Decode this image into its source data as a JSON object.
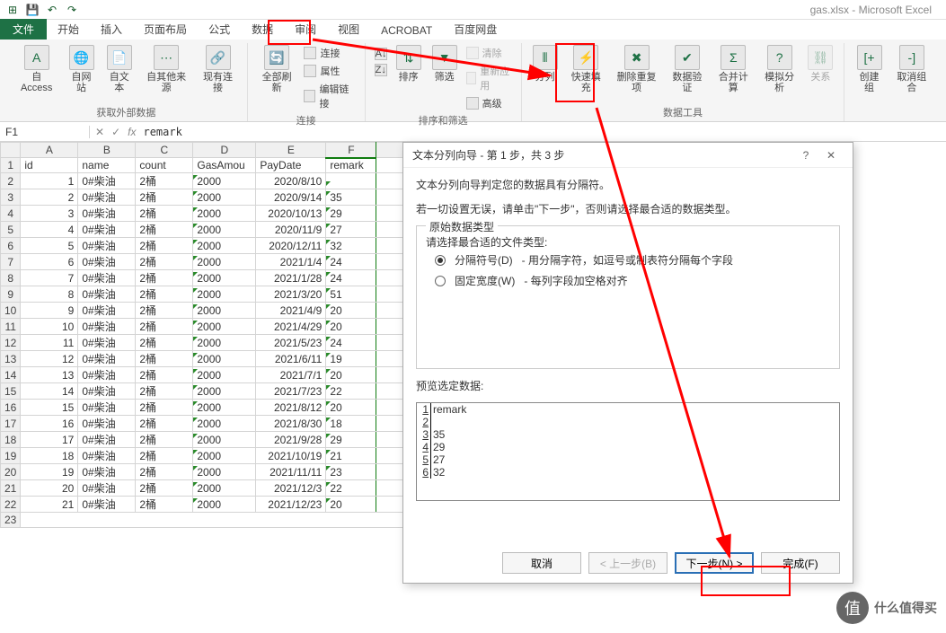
{
  "app": {
    "title": "gas.xlsx - Microsoft Excel"
  },
  "tabs": {
    "file": "文件",
    "home": "开始",
    "insert": "插入",
    "page": "页面布局",
    "formula": "公式",
    "data": "数据",
    "review": "审阅",
    "view": "视图",
    "acrobat": "ACROBAT",
    "baidu": "百度网盘"
  },
  "ribbon": {
    "group1": {
      "access": "自 Access",
      "web": "自网站",
      "text": "自文本",
      "other": "自其他来源",
      "existing": "现有连接",
      "label": "获取外部数据"
    },
    "group2": {
      "refresh": "全部刷新",
      "conn": "连接",
      "prop": "属性",
      "edit": "编辑链接",
      "label": "连接"
    },
    "group3": {
      "sort": "排序",
      "filter": "筛选",
      "clear": "清除",
      "reapply": "重新应用",
      "adv": "高级",
      "label": "排序和筛选"
    },
    "group4": {
      "split": "分列",
      "flash": "快速填充",
      "dup": "删除重复项",
      "valid": "数据验证",
      "consol": "合并计算",
      "whatif": "模拟分析",
      "rel": "关系",
      "label": "数据工具"
    },
    "group5": {
      "group": "创建组",
      "ungroup": "取消组合"
    }
  },
  "formula_bar": {
    "cell": "F1",
    "value": "remark"
  },
  "columns": [
    "A",
    "B",
    "C",
    "D",
    "E",
    "F"
  ],
  "headers": {
    "id": "id",
    "name": "name",
    "count": "count",
    "gas": "GasAmou",
    "pay": "PayDate",
    "remark": "remark"
  },
  "rows": [
    {
      "id": 1,
      "name": "0#柴油",
      "count": "2桶",
      "gas": "2000",
      "pay": "2020/8/10",
      "remark": ""
    },
    {
      "id": 2,
      "name": "0#柴油",
      "count": "2桶",
      "gas": "2000",
      "pay": "2020/9/14",
      "remark": "35"
    },
    {
      "id": 3,
      "name": "0#柴油",
      "count": "2桶",
      "gas": "2000",
      "pay": "2020/10/13",
      "remark": "29"
    },
    {
      "id": 4,
      "name": "0#柴油",
      "count": "2桶",
      "gas": "2000",
      "pay": "2020/11/9",
      "remark": "27"
    },
    {
      "id": 5,
      "name": "0#柴油",
      "count": "2桶",
      "gas": "2000",
      "pay": "2020/12/11",
      "remark": "32"
    },
    {
      "id": 6,
      "name": "0#柴油",
      "count": "2桶",
      "gas": "2000",
      "pay": "2021/1/4",
      "remark": "24"
    },
    {
      "id": 7,
      "name": "0#柴油",
      "count": "2桶",
      "gas": "2000",
      "pay": "2021/1/28",
      "remark": "24"
    },
    {
      "id": 8,
      "name": "0#柴油",
      "count": "2桶",
      "gas": "2000",
      "pay": "2021/3/20",
      "remark": "51"
    },
    {
      "id": 9,
      "name": "0#柴油",
      "count": "2桶",
      "gas": "2000",
      "pay": "2021/4/9",
      "remark": "20"
    },
    {
      "id": 10,
      "name": "0#柴油",
      "count": "2桶",
      "gas": "2000",
      "pay": "2021/4/29",
      "remark": "20"
    },
    {
      "id": 11,
      "name": "0#柴油",
      "count": "2桶",
      "gas": "2000",
      "pay": "2021/5/23",
      "remark": "24"
    },
    {
      "id": 12,
      "name": "0#柴油",
      "count": "2桶",
      "gas": "2000",
      "pay": "2021/6/11",
      "remark": "19"
    },
    {
      "id": 13,
      "name": "0#柴油",
      "count": "2桶",
      "gas": "2000",
      "pay": "2021/7/1",
      "remark": "20"
    },
    {
      "id": 14,
      "name": "0#柴油",
      "count": "2桶",
      "gas": "2000",
      "pay": "2021/7/23",
      "remark": "22"
    },
    {
      "id": 15,
      "name": "0#柴油",
      "count": "2桶",
      "gas": "2000",
      "pay": "2021/8/12",
      "remark": "20"
    },
    {
      "id": 16,
      "name": "0#柴油",
      "count": "2桶",
      "gas": "2000",
      "pay": "2021/8/30",
      "remark": "18"
    },
    {
      "id": 17,
      "name": "0#柴油",
      "count": "2桶",
      "gas": "2000",
      "pay": "2021/9/28",
      "remark": "29"
    },
    {
      "id": 18,
      "name": "0#柴油",
      "count": "2桶",
      "gas": "2000",
      "pay": "2021/10/19",
      "remark": "21"
    },
    {
      "id": 19,
      "name": "0#柴油",
      "count": "2桶",
      "gas": "2000",
      "pay": "2021/11/11",
      "remark": "23"
    },
    {
      "id": 20,
      "name": "0#柴油",
      "count": "2桶",
      "gas": "2000",
      "pay": "2021/12/3",
      "remark": "22"
    },
    {
      "id": 21,
      "name": "0#柴油",
      "count": "2桶",
      "gas": "2000",
      "pay": "2021/12/23",
      "remark": "20"
    }
  ],
  "dialog": {
    "title": "文本分列向导 - 第 1 步，共 3 步",
    "line1": "文本分列向导判定您的数据具有分隔符。",
    "line2": "若一切设置无误，请单击\"下一步\"，否则请选择最合适的数据类型。",
    "fieldset_title": "原始数据类型",
    "choose": "请选择最合适的文件类型:",
    "opt1": "分隔符号(D)",
    "opt1_desc": "- 用分隔字符，如逗号或制表符分隔每个字段",
    "opt2": "固定宽度(W)",
    "opt2_desc": "- 每列字段加空格对齐",
    "preview_label": "预览选定数据:",
    "preview": [
      "remark",
      "",
      "35",
      "29",
      "27",
      "32"
    ],
    "btn_cancel": "取消",
    "btn_back": "< 上一步(B)",
    "btn_next": "下一步(N) >",
    "btn_finish": "完成(F)"
  },
  "watermark": "什么值得买"
}
